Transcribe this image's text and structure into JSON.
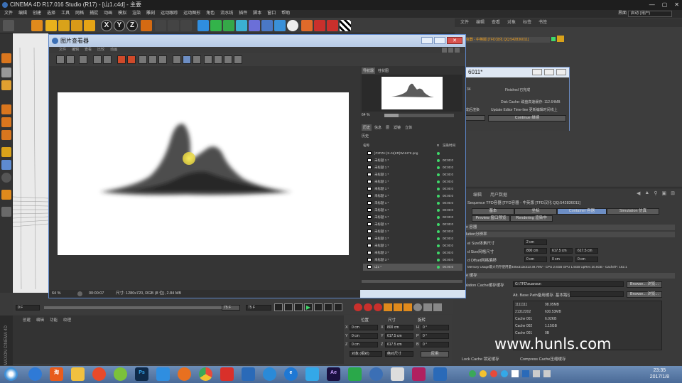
{
  "app": {
    "title": "CINEMA 4D R17.016 Studio (R17) - [山1.c4d] - 主要",
    "window_controls": [
      "—",
      "▢",
      "✕"
    ],
    "right_menu_label": "界面",
    "right_menu_value": "启动 (用户)"
  },
  "menubar": [
    "文件",
    "编辑",
    "创建",
    "选择",
    "工具",
    "网格",
    "捕捉",
    "动画",
    "模拟",
    "渲染",
    "雕刻",
    "运动跟踪",
    "运动图形",
    "角色",
    "流水线",
    "插件",
    "脚本",
    "窗口",
    "帮助"
  ],
  "toolbar": {
    "axis_x": "X",
    "axis_y": "Y",
    "axis_z": "Z"
  },
  "right_panel": {
    "menu": [
      "文件",
      "编辑",
      "查看",
      "对象",
      "标签",
      "书签"
    ],
    "object_row": "TFD容器 - 中英版 [TFD汉化 QQ:542836011]"
  },
  "render_dialog": {
    "title": "6011*",
    "percent": "34",
    "status": "Finished 已完成",
    "disk_cache": "Disk Cache: 磁盘高速缓存: 112.64MB",
    "left_label": "成后渲染",
    "check_label": "Update Editor Time-line 更新编辑时间线上",
    "continue": "Continue 继续"
  },
  "attributes": {
    "menu": [
      "编辑",
      "用户数据"
    ],
    "object_line": "Sequence TFD容器 [TFD容器 - 中英版 [TFD汉化 QQ:542836011]",
    "tabs": [
      "基本",
      "坐标",
      "Container 容器",
      "Simulation 仿真"
    ],
    "tabs2": [
      "Preview 窗口预览",
      "Rendering 渲染中"
    ],
    "section1": "er 容器",
    "section2": "lution分辨率",
    "voxel_label": "el Size体素尺寸",
    "voxel_val": "2 cm",
    "grid_label": "d Size网格尺寸",
    "grid_vals": [
      "800 cm",
      "617.5 cm",
      "617.5 cm"
    ],
    "offset_label": "d Offset网格偏移",
    "offset_vals": [
      "0 cm",
      "0 cm",
      "0 cm"
    ],
    "memory_line": "Memory Usage最大内存使用量405x313x313 39.7MV - CPU 2.6GB GPU 1.5GB UpRes 20.5GB - Cache/F: 162.1",
    "section3": "e 缓存",
    "cache_label": "ulation Cache缓存缓存",
    "cache_path": "G:\\TFD\\xuanxun",
    "browse": "Browse... 浏览...",
    "alt_label": "Alt. Base Path备用缓存. 基本路径",
    "cache_list": [
      [
        "1111111",
        "98.05MB"
      ],
      [
        "21312202",
        "630.53MB"
      ],
      [
        "Cache 001",
        "6.02KB"
      ],
      [
        "Cache 002",
        "1.15GB"
      ],
      [
        "Cache 001",
        "0B"
      ]
    ],
    "lock_cache": "Lock Cache 锁定缓存",
    "compress_cache": "Compress Cache压缩缓存"
  },
  "picture_viewer": {
    "title": "图片查看器",
    "menu": [
      "文件",
      "编辑",
      "查看",
      "比较",
      "动画"
    ],
    "tabs": [
      "导航器",
      "柱状图"
    ],
    "nav_zoom": "64 %",
    "side_tabs": [
      "历史",
      "信息",
      "层",
      "滤镜",
      "立体"
    ],
    "history_label": "历史",
    "history_header": {
      "name": "名称",
      "r": "R",
      "time": "渲染时间"
    },
    "history_items": [
      {
        "name": "}F2FZH )S~N(KR)WHH7K.png",
        "time": ""
      },
      {
        "name": "未标题 1 *",
        "time": "00:00:0"
      },
      {
        "name": "未标题 1 *",
        "time": "00:00:0"
      },
      {
        "name": "未标题 1 *",
        "time": "00:00:0"
      },
      {
        "name": "未标题 1 *",
        "time": "00:00:0"
      },
      {
        "name": "未标题 1 *",
        "time": "00:00:0"
      },
      {
        "name": "未标题 1 *",
        "time": "00:00:0"
      },
      {
        "name": "未标题 1 *",
        "time": "00:00:0"
      },
      {
        "name": "未标题 1 *",
        "time": "00:00:0"
      },
      {
        "name": "未标题 1 *",
        "time": "00:00:0"
      },
      {
        "name": "未标题 1 *",
        "time": "00:00:0"
      },
      {
        "name": "未标题 1 *",
        "time": "00:00:0"
      },
      {
        "name": "未标题 1 *",
        "time": "00:00:0"
      },
      {
        "name": "未标题 1 *",
        "time": "00:00:0"
      },
      {
        "name": "未标题 3 *",
        "time": "00:00:0"
      },
      {
        "name": "未标题 3 *",
        "time": "00:00:0"
      },
      {
        "name": "山1 *",
        "time": "00:00:0"
      }
    ],
    "zoom": "64 %",
    "time": "00:00:07",
    "size_info": "尺寸: 1280x720, RGB (8 位), 2.84 MB"
  },
  "timeline": {
    "start": "0 F",
    "end": "75 F",
    "current": "75 F"
  },
  "lower_panel": {
    "menu": [
      "创建",
      "编辑",
      "功能",
      "纹理"
    ],
    "coord_headers": [
      "位置",
      "尺寸",
      "旋转"
    ],
    "coord_rows": [
      {
        "axis": "X",
        "pos": "0 cm",
        "size": "800 cm",
        "rot_axis": "H",
        "rot": "0 °"
      },
      {
        "axis": "Y",
        "pos": "0 cm",
        "size": "617.5 cm",
        "rot_axis": "P",
        "rot": "0 °"
      },
      {
        "axis": "Z",
        "pos": "0 cm",
        "size": "617.5 cm",
        "rot_axis": "B",
        "rot": "0 °"
      }
    ],
    "mode_select": "对象 (相对)",
    "size_select": "绝对尺寸",
    "apply": "应用"
  },
  "brand": {
    "side_logo": "MAXON CINEMA 4D"
  },
  "watermark": "www.hunls.com",
  "taskbar": {
    "time": "23:35",
    "date": "2017/1/8",
    "apps": [
      "start",
      "ie",
      "taobao",
      "explorer",
      "player",
      "ps",
      "cloud",
      "orange",
      "chrome",
      "rec",
      "bird",
      "blue",
      "edge",
      "cloud2",
      "ae",
      "wechat",
      "c4d",
      "rec2",
      "dialog",
      "shield"
    ]
  },
  "colors": {
    "accent": "#5d86c8",
    "green_dot": "#3fd96a",
    "bg": "#3a3a3a"
  }
}
